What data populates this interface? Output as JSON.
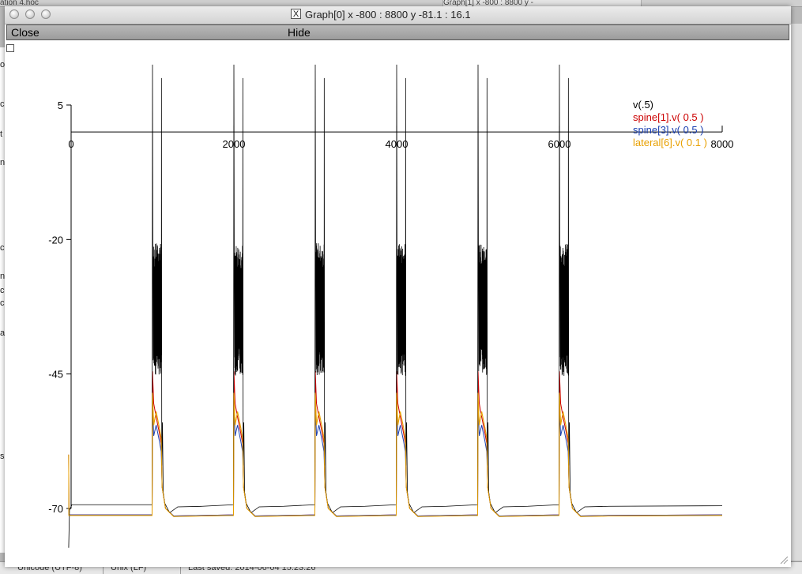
{
  "background": {
    "left_title_fragment": "ation 4.hoc",
    "right_title_fragment": "Graph[1]  x -800 : 8800  y -",
    "left_strip_letters": [
      "o",
      "c",
      "t",
      "n",
      "c",
      "n",
      "c",
      "c",
      "a",
      "s"
    ],
    "statusbar": {
      "encoding": "Unicode (UTF-8)",
      "line_endings": "Unix (LF)",
      "last_saved": "Last saved: 2014-06-04 15:23:26"
    }
  },
  "window": {
    "icon": "x11-icon",
    "title": "Graph[0]  x -800 : 8800  y -81.1 : 16.1",
    "menu": {
      "close_label": "Close",
      "hide_label": "Hide"
    }
  },
  "chart_data": {
    "type": "line",
    "xlim": [
      -800,
      8800
    ],
    "ylim": [
      -81.1,
      16.1
    ],
    "x_axis_at_y": 0,
    "x_ticks": [
      0,
      2000,
      4000,
      6000,
      8000
    ],
    "x_tick_labels": [
      "0",
      "2000",
      "4000",
      "6000",
      "8000"
    ],
    "y_ticks": [
      5,
      -20,
      -45,
      -70
    ],
    "y_tick_labels": [
      "5",
      "-20",
      "-45",
      "-70"
    ],
    "x_axis_range": [
      0,
      8000
    ],
    "y_axis_range": [
      -70,
      5
    ],
    "grid": false,
    "legend_position": "top-right",
    "bursts_x": [
      1000,
      2000,
      3000,
      4000,
      5000,
      6000
    ],
    "series": [
      {
        "name": "v(.5)",
        "color": "#000000",
        "baseline": -69.3,
        "peak": 12.5,
        "burst_center": -33,
        "burst_amplitude": 9.5
      },
      {
        "name": "spine[1].v( 0.5 )",
        "color": "#cc0000",
        "baseline": -71.2,
        "peak": -44.5
      },
      {
        "name": "spine[3].v( 0.5 )",
        "color": "#1a3fb0",
        "baseline": -71.2,
        "peak": -50.5
      },
      {
        "name": "lateral[6].v( 0.1 )",
        "color": "#e8a000",
        "baseline": -71.3,
        "peak": -48.5
      }
    ]
  }
}
